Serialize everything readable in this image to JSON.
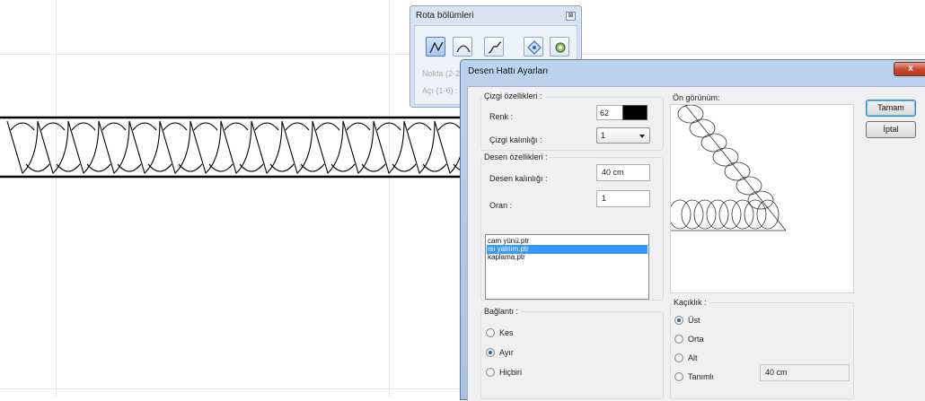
{
  "palette": {
    "title": "Rota bölümleri",
    "close_glyph": "⊠",
    "tools": [
      "polyline-icon",
      "arc-icon",
      "spline-icon",
      "node-edit-icon",
      "settings-icon"
    ],
    "nokta_label": "Nokta (2-2",
    "aci_label": "Açı (1-6) :"
  },
  "dialog": {
    "title": "Desen Hattı Ayarları",
    "close_glyph": "x",
    "cizgi": {
      "group_label": "Çizgi özellikleri :",
      "renk_label": "Renk :",
      "renk_value": "62",
      "renk_color": "#000000",
      "kalinlik_label": "Çizgi kalınlığı :",
      "kalinlik_value": "1"
    },
    "desen": {
      "group_label": "Desen özellikleri :",
      "kalinlik_label": "Desen kalınlığı :",
      "kalinlik_value": "40 cm",
      "oran_label": "Oran :",
      "oran_value": "1",
      "files": [
        "cam yünü.ptr",
        "ısı yalıtım.ptr",
        "kaplama.ptr"
      ],
      "selected_index": 1
    },
    "baglanti": {
      "group_label": "Bağlantı :",
      "options": [
        "Kes",
        "Ayır",
        "Hiçbiri"
      ],
      "selected_index": 1
    },
    "onizleme_label": "Ön görünüm:",
    "kaciklik": {
      "group_label": "Kaçıklık :",
      "options": [
        "Üst",
        "Orta",
        "Alt",
        "Tanımlı"
      ],
      "selected_index": 0,
      "tanimli_value": "40 cm"
    },
    "ok_label": "Tamam",
    "cancel_label": "İptal"
  }
}
